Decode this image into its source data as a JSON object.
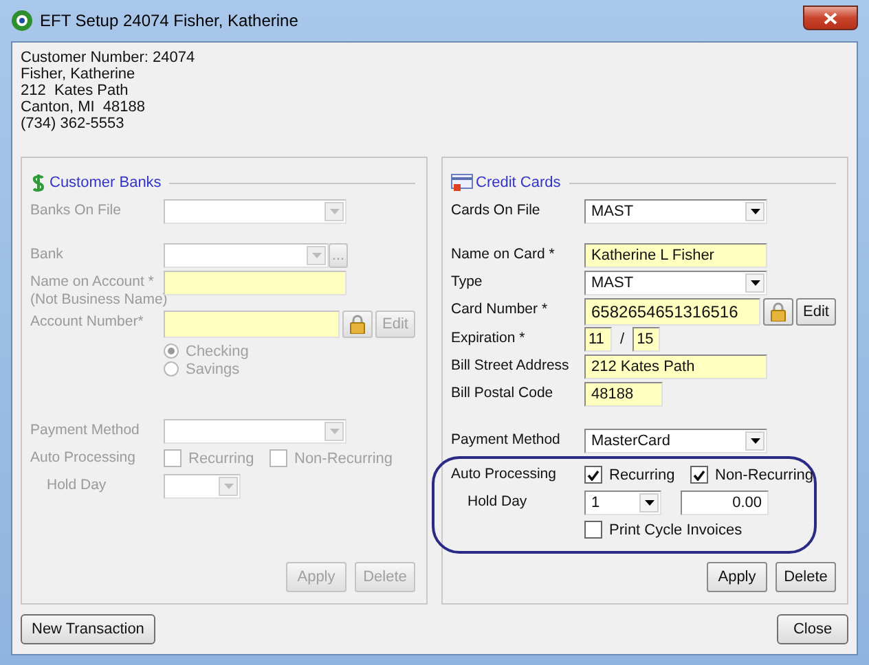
{
  "window": {
    "title": "EFT Setup 24074 Fisher, Katherine"
  },
  "customer": [
    "Customer Number: 24074",
    "Fisher, Katherine",
    "212  Kates Path",
    "Canton, MI  48188",
    "(734) 362-5553"
  ],
  "panels": [
    {
      "title": "Customer Banks",
      "disabled": true,
      "rows": [
        {
          "kind": "select",
          "label": "Banks On File"
        },
        {
          "kind": "lookup",
          "label": "Bank",
          "button": "..."
        },
        {
          "kind": "text",
          "label": "Name on Account *",
          "note": "(Not Business Name)",
          "required": true
        },
        {
          "kind": "secure",
          "label": "Account Number*",
          "required": true,
          "button": "Edit"
        },
        {
          "kind": "radios",
          "options": [
            {
              "label": "Checking",
              "selected": true
            },
            {
              "label": "Savings",
              "selected": false
            }
          ]
        }
      ],
      "footer_rows": [
        {
          "kind": "select",
          "label": "Payment Method"
        },
        {
          "kind": "checks",
          "label": "Auto Processing",
          "options": [
            {
              "label": "Recurring",
              "checked": false
            },
            {
              "label": "Non-Recurring",
              "checked": false
            }
          ]
        },
        {
          "kind": "holdday",
          "label": "Hold Day"
        }
      ],
      "buttons": [
        "Apply",
        "Delete"
      ]
    },
    {
      "title": "Credit Cards",
      "disabled": false,
      "rows": [
        {
          "kind": "select",
          "label": "Cards On File",
          "value": "MAST"
        },
        {
          "kind": "text",
          "label": "Name on Card *",
          "value": "Katherine L Fisher",
          "required": true
        },
        {
          "kind": "select",
          "label": "Type",
          "value": "MAST"
        },
        {
          "kind": "secure",
          "label": "Card Number *",
          "value": "6582654651316516",
          "required": true,
          "button": "Edit"
        },
        {
          "kind": "expiration",
          "label": "Expiration *",
          "month": "11",
          "separator": "/",
          "year": "15",
          "required": true
        },
        {
          "kind": "text",
          "label": "Bill Street Address",
          "value": "212  Kates Path",
          "required": true
        },
        {
          "kind": "short_text",
          "label": "Bill Postal Code",
          "value": "48188",
          "required": true
        }
      ],
      "footer_rows": [
        {
          "kind": "select",
          "label": "Payment Method",
          "value": "MasterCard"
        },
        {
          "kind": "circled",
          "rows": [
            {
              "kind": "checks",
              "label": "Auto Processing",
              "options": [
                {
                  "label": "Recurring",
                  "checked": true
                },
                {
                  "label": "Non-Recurring",
                  "checked": true
                }
              ]
            },
            {
              "kind": "holdday",
              "label": "Hold Day",
              "value": "1",
              "amount": "0.00"
            },
            {
              "kind": "checkbox",
              "label": "Print Cycle Invoices",
              "checked": false
            }
          ]
        }
      ],
      "buttons": [
        "Apply",
        "Delete"
      ]
    }
  ],
  "buttons": [
    {
      "label": "New Transaction"
    },
    {
      "label": "Close"
    }
  ]
}
